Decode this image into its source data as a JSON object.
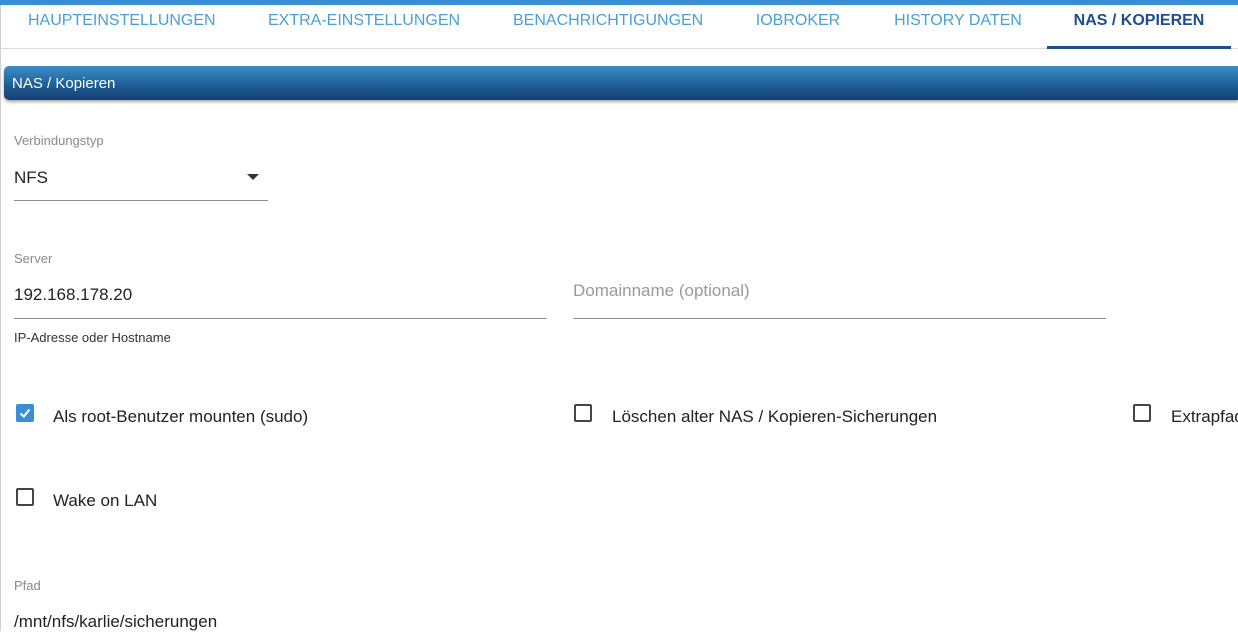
{
  "tabs": [
    {
      "label": "HAUPTEINSTELLUNGEN"
    },
    {
      "label": "EXTRA-EINSTELLUNGEN"
    },
    {
      "label": "BENACHRICHTIGUNGEN"
    },
    {
      "label": "IOBROKER"
    },
    {
      "label": "HISTORY DATEN"
    },
    {
      "label": "NAS / KOPIEREN",
      "active": true
    }
  ],
  "panel": {
    "title": "NAS / Kopieren"
  },
  "connection_type": {
    "label": "Verbindungstyp",
    "value": "NFS"
  },
  "server": {
    "label": "Server",
    "value": "192.168.178.20",
    "helper": "IP-Adresse oder Hostname"
  },
  "domain": {
    "placeholder": "Domainname (optional)",
    "value": ""
  },
  "checkboxes": {
    "sudo": {
      "label": "Als root-Benutzer mounten (sudo)",
      "checked": true
    },
    "delete_old": {
      "label": "Löschen alter NAS / Kopieren-Sicherungen",
      "checked": false
    },
    "extra_path": {
      "label": "Extrapfad",
      "checked": false
    },
    "wol": {
      "label": "Wake on LAN",
      "checked": false
    }
  },
  "path": {
    "label": "Pfad",
    "value": "/mnt/nfs/karlie/sicherungen"
  },
  "colors": {
    "accent": "#3a8ed6",
    "tab_text": "#4a9fd6",
    "tab_active": "#1f4d8f"
  }
}
